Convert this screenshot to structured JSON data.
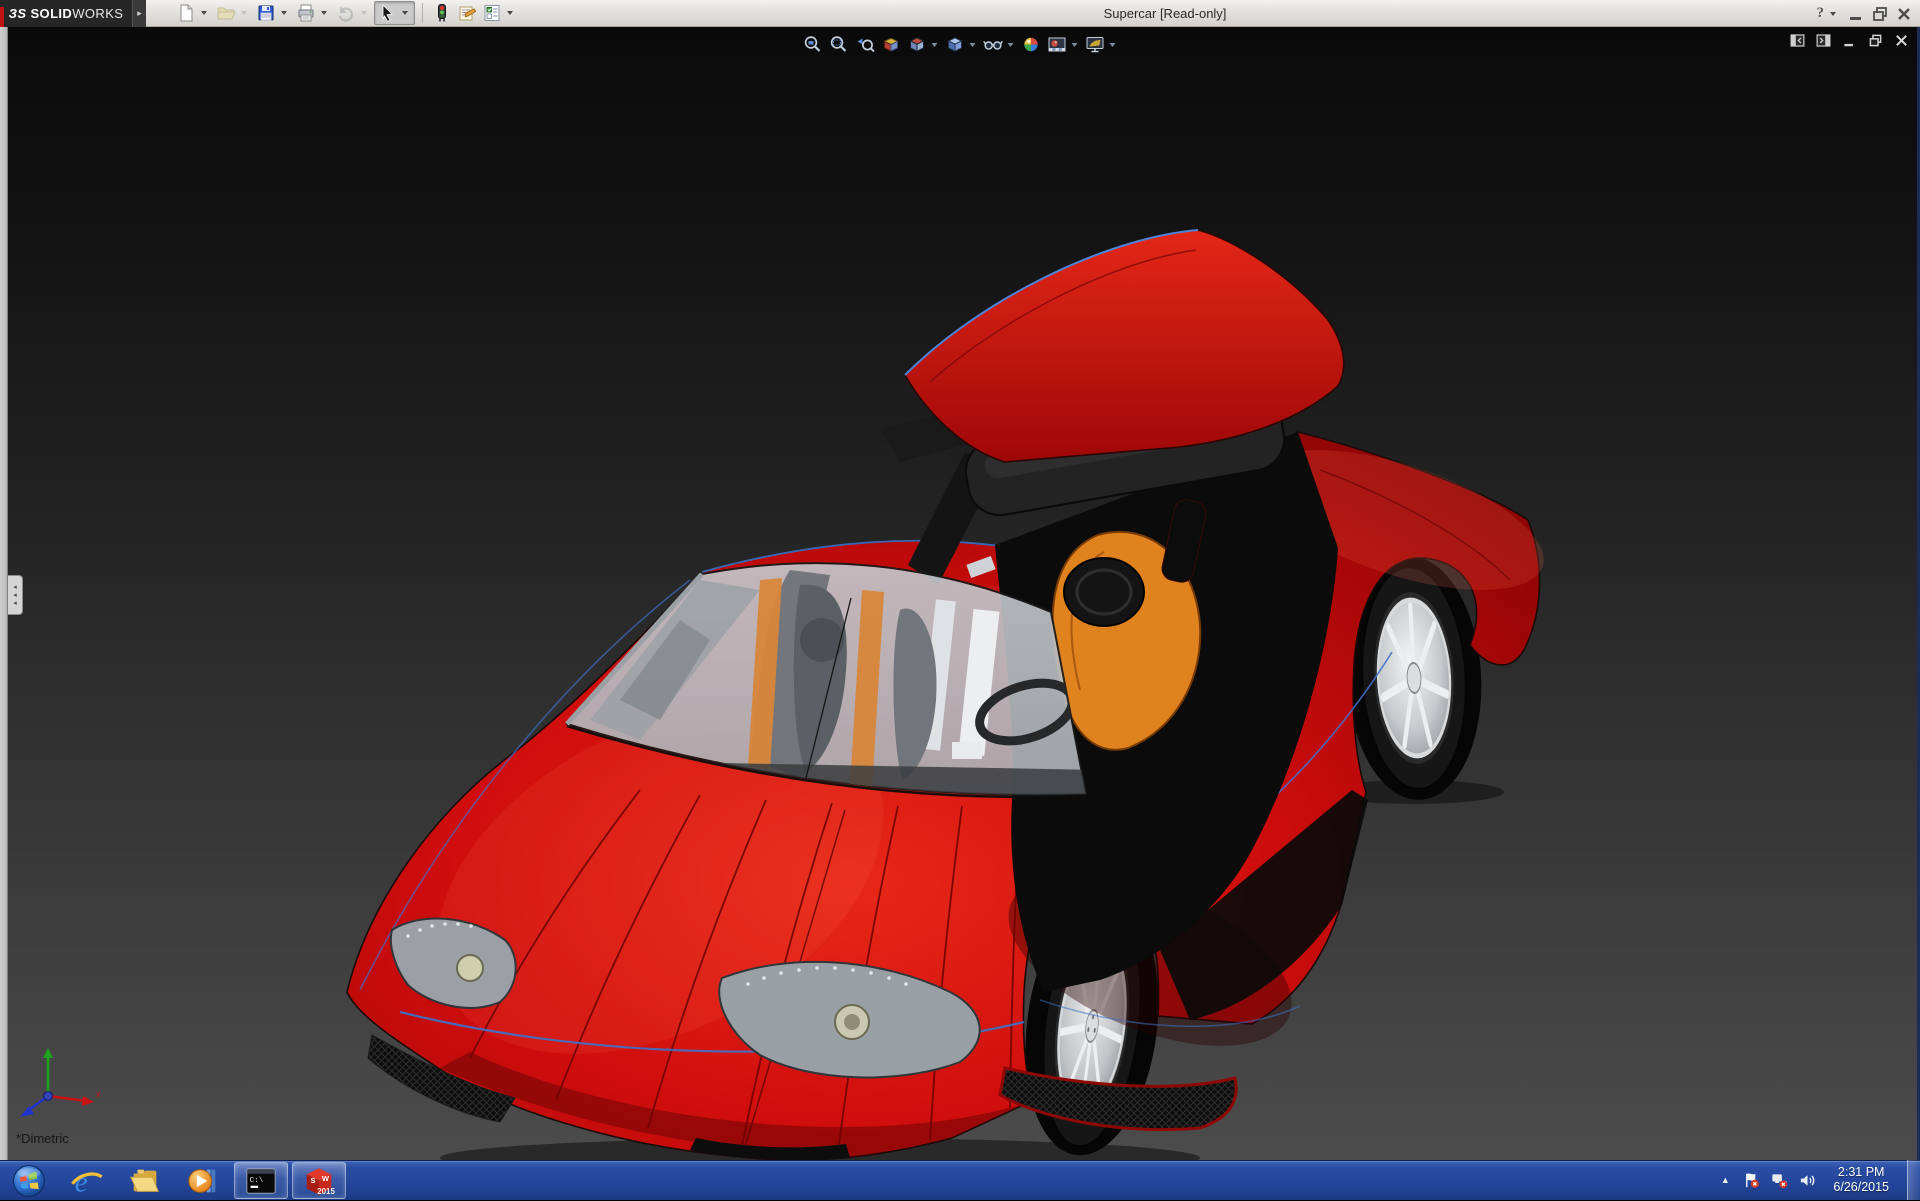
{
  "titlebar": {
    "logo_mark": "ЗS",
    "logo_bold": "SOLID",
    "logo_light": "WORKS",
    "expand_glyph": "▸",
    "title": "Supercar [Read-only]",
    "help_glyph": "?"
  },
  "main_toolbar": {
    "items": [
      {
        "name": "new-document",
        "icon": "new-document-icon",
        "dropdown": true
      },
      {
        "name": "open",
        "icon": "open-folder-icon",
        "dropdown": true,
        "disabled": true
      },
      {
        "name": "save",
        "icon": "save-icon",
        "dropdown": true
      },
      {
        "name": "print",
        "icon": "print-icon",
        "dropdown": true
      },
      {
        "name": "undo",
        "icon": "undo-icon",
        "dropdown": true,
        "disabled": true
      },
      {
        "name": "select",
        "icon": "select-cursor-icon",
        "dropdown": true,
        "pressed": true
      },
      {
        "type": "separator"
      },
      {
        "name": "stoplight",
        "icon": "stoplight-icon"
      },
      {
        "name": "comment",
        "icon": "comment-note-icon"
      },
      {
        "name": "properties",
        "icon": "checklist-icon",
        "dropdown": true
      }
    ]
  },
  "headsup_toolbar": {
    "items": [
      {
        "name": "zoom-to-fit",
        "icon": "zoom-fit-icon"
      },
      {
        "name": "zoom-to-area",
        "icon": "zoom-area-icon"
      },
      {
        "name": "previous-view",
        "icon": "previous-view-icon"
      },
      {
        "name": "section-view",
        "icon": "section-view-icon"
      },
      {
        "name": "view-orientation",
        "icon": "view-orientation-icon",
        "dropdown": true
      },
      {
        "name": "display-style",
        "icon": "display-style-icon",
        "dropdown": true
      },
      {
        "name": "hide-show-items",
        "icon": "glasses-icon",
        "dropdown": true
      },
      {
        "name": "edit-appearance",
        "icon": "appearance-ball-icon"
      },
      {
        "name": "apply-scene",
        "icon": "apply-scene-icon",
        "dropdown": true
      },
      {
        "name": "view-settings",
        "icon": "view-settings-icon",
        "dropdown": true
      }
    ]
  },
  "doc_window": {
    "controls": [
      {
        "name": "collapse-pane-left",
        "icon": "pane-left-icon"
      },
      {
        "name": "collapse-pane-right",
        "icon": "pane-right-icon"
      },
      {
        "name": "minimize-document",
        "icon": "minimize-icon"
      },
      {
        "name": "restore-document",
        "icon": "restore-icon"
      },
      {
        "name": "close-document",
        "icon": "close-icon"
      }
    ]
  },
  "viewport": {
    "view_label": "*Dimetric",
    "panel_tab_glyph": "◂"
  },
  "taskbar": {
    "buttons": [
      {
        "name": "start",
        "icon": "start-orb-icon"
      },
      {
        "name": "internet-explorer",
        "icon": "ie-icon"
      },
      {
        "name": "file-explorer",
        "icon": "explorer-icon"
      },
      {
        "name": "media-player",
        "icon": "wmp-icon"
      },
      {
        "name": "command-prompt",
        "icon": "cmd-icon",
        "icon_text": "C:\\",
        "active": true
      },
      {
        "name": "solidworks-2015",
        "icon": "sw-icon",
        "icon_text": "2015",
        "active": true
      }
    ],
    "tray": {
      "hidden_icons_glyph": "▲",
      "icons": [
        {
          "name": "action-center",
          "icon": "flag-icon"
        },
        {
          "name": "network-status",
          "icon": "network-icon"
        },
        {
          "name": "volume",
          "icon": "speaker-icon"
        }
      ],
      "time": "2:31 PM",
      "date": "6/26/2015"
    }
  },
  "colors": {
    "body_red": "#cf0d0d",
    "body_red_dark": "#8e0505",
    "body_red_light": "#ef3b2a",
    "seat_orange": "#e0831f",
    "edge_blue": "#4a7bd0",
    "taskbar_blue": "#25489e",
    "titlebar_gray": "#dcd9d4",
    "glass_gray": "#b9bec3",
    "rim_silver": "#d7d9da"
  }
}
